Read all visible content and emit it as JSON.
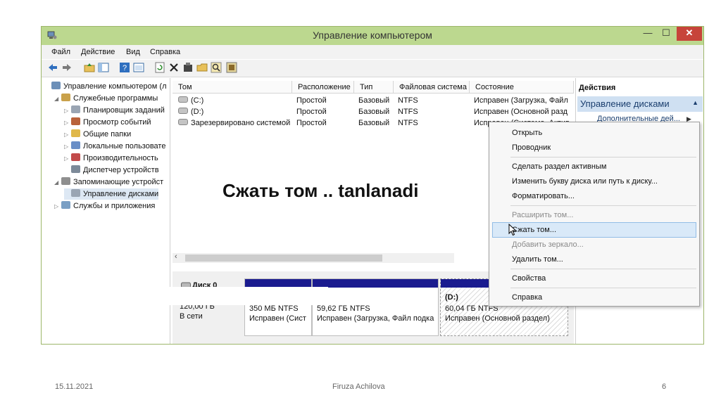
{
  "window": {
    "title": "Управление компьютером",
    "controls": {
      "minimize": "—",
      "maximize": "☐",
      "close": "✕"
    }
  },
  "menu": [
    "Файл",
    "Действие",
    "Вид",
    "Справка"
  ],
  "toolbar": {
    "icons": [
      "back-icon",
      "forward-icon",
      "folder-up-icon",
      "show-hide-tree-icon",
      "help-icon",
      "console-icon",
      "refresh-icon",
      "delete-icon",
      "properties-icon",
      "open-folder-icon",
      "search-icon",
      "disk-properties-icon"
    ]
  },
  "tree": [
    {
      "label": "Управление компьютером (л",
      "depth": 0,
      "arrow": "",
      "icon": "computer-icon"
    },
    {
      "label": "Служебные программы",
      "depth": 1,
      "arrow": "◢",
      "icon": "tools-icon"
    },
    {
      "label": "Планировщик заданий",
      "depth": 2,
      "arrow": "▷",
      "icon": "clock-icon"
    },
    {
      "label": "Просмотр событий",
      "depth": 2,
      "arrow": "▷",
      "icon": "event-viewer-icon"
    },
    {
      "label": "Общие папки",
      "depth": 2,
      "arrow": "▷",
      "icon": "shared-folder-icon"
    },
    {
      "label": "Локальные пользовате",
      "depth": 2,
      "arrow": "▷",
      "icon": "users-icon"
    },
    {
      "label": "Производительность",
      "depth": 2,
      "arrow": "▷",
      "icon": "performance-icon"
    },
    {
      "label": "Диспетчер устройств",
      "depth": 2,
      "arrow": "",
      "icon": "device-manager-icon"
    },
    {
      "label": "Запоминающие устройст",
      "depth": 1,
      "arrow": "◢",
      "icon": "storage-icon"
    },
    {
      "label": "Управление дисками",
      "depth": 2,
      "arrow": "",
      "icon": "disk-management-icon",
      "selected": true
    },
    {
      "label": "Службы и приложения",
      "depth": 1,
      "arrow": "▷",
      "icon": "services-icon"
    }
  ],
  "volumes": {
    "headers": [
      "Том",
      "Расположение",
      "Тип",
      "Файловая система",
      "Состояние"
    ],
    "rows": [
      [
        "(C:)",
        "Простой",
        "Базовый",
        "NTFS",
        "Исправен (Загрузка, Файл"
      ],
      [
        "(D:)",
        "Простой",
        "Базовый",
        "NTFS",
        "Исправен (Основной разд"
      ],
      [
        "Зарезервировано системой",
        "Простой",
        "Базовый",
        "NTFS",
        "Исправен (Система, Актив"
      ]
    ]
  },
  "disk": {
    "name": "Диск 0",
    "size": "120,00 ГБ",
    "status": "В сети",
    "partitions": [
      {
        "label": "",
        "size": "350 МБ NTFS",
        "status": "Исправен (Сист"
      },
      {
        "label": "",
        "size": "59,62 ГБ NTFS",
        "status": "Исправен (Загрузка, Файл подка"
      },
      {
        "label": "(D:)",
        "size": "60,04 ГБ NTFS",
        "status": "Исправен (Основной раздел)"
      }
    ]
  },
  "actions": {
    "header": "Действия",
    "group": "Управление дисками",
    "more": "Дополнительные дей..."
  },
  "context_menu": {
    "items": [
      {
        "label": "Открыть",
        "enabled": true
      },
      {
        "label": "Проводник",
        "enabled": true
      },
      {
        "label": "Сделать раздел активным",
        "enabled": true
      },
      {
        "label": "Изменить букву диска или путь к диску...",
        "enabled": true
      },
      {
        "label": "Форматировать...",
        "enabled": true
      },
      {
        "label": "Расширить том...",
        "enabled": false
      },
      {
        "label": "Сжать том...",
        "enabled": true,
        "highlighted": true
      },
      {
        "label": "Добавить зеркало...",
        "enabled": false
      },
      {
        "label": "Удалить том...",
        "enabled": true
      },
      {
        "label": "Свойства",
        "enabled": true
      },
      {
        "label": "Справка",
        "enabled": true
      }
    ]
  },
  "overlay_text": "Сжать том .. tanlanadi",
  "footer": {
    "date": "15.11.2021",
    "author": "Firuza Achilova",
    "page": "6"
  },
  "colors": {
    "titlebar": "#bcd88f",
    "partition_bar": "#1a1b8f",
    "highlight": "#d9e9f8",
    "close_button": "#c7443a"
  }
}
